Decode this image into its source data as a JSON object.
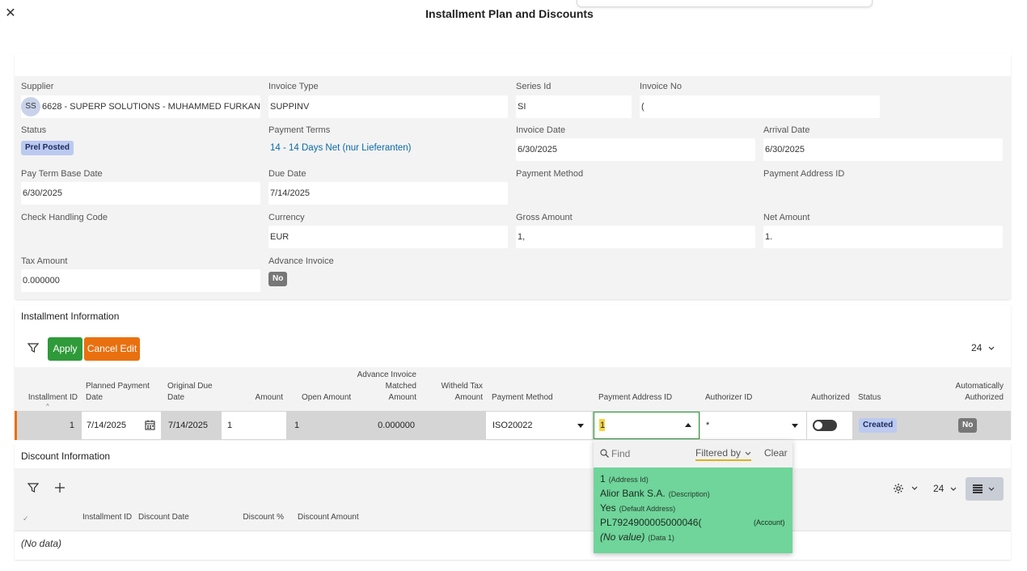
{
  "dialog": {
    "title": "Installment Plan and Discounts"
  },
  "header": {
    "supplier": {
      "label": "Supplier",
      "initials": "SS",
      "value": "6628 - SUPERP SOLUTIONS - MUHAMMED FURKAN ..."
    },
    "invoice_type": {
      "label": "Invoice Type",
      "value": "SUPPINV"
    },
    "series_id": {
      "label": "Series Id",
      "value": "SI"
    },
    "invoice_no": {
      "label": "Invoice No",
      "value": "("
    },
    "status": {
      "label": "Status",
      "value": "Prel Posted"
    },
    "payment_terms": {
      "label": "Payment Terms",
      "value": "14 - 14 Days Net (nur Lieferanten)"
    },
    "invoice_date": {
      "label": "Invoice Date",
      "value": "6/30/2025"
    },
    "arrival_date": {
      "label": "Arrival Date",
      "value": "6/30/2025"
    },
    "pay_term_base_date": {
      "label": "Pay Term Base Date",
      "value": "6/30/2025"
    },
    "due_date": {
      "label": "Due Date",
      "value": "7/14/2025"
    },
    "payment_method": {
      "label": "Payment Method",
      "value": ""
    },
    "payment_address_id": {
      "label": "Payment Address ID",
      "value": ""
    },
    "check_handling_code": {
      "label": "Check Handling Code",
      "value": ""
    },
    "currency": {
      "label": "Currency",
      "value": "EUR"
    },
    "gross_amount": {
      "label": "Gross Amount",
      "value": "1,"
    },
    "net_amount": {
      "label": "Net Amount",
      "value": "1."
    },
    "tax_amount": {
      "label": "Tax Amount",
      "value": "0.000000"
    },
    "advance_invoice": {
      "label": "Advance Invoice",
      "value": "No"
    }
  },
  "installment": {
    "title": "Installment Information",
    "apply_label": "Apply",
    "cancel_label": "Cancel Edit",
    "page_size": "24",
    "columns": {
      "installment_id": "Installment ID",
      "planned_payment_date_1": "Planned Payment",
      "planned_payment_date_2": "Date",
      "original_due_date_1": "Original Due",
      "original_due_date_2": "Date",
      "amount": "Amount",
      "open_amount": "Open Amount",
      "adv_1": "Advance Invoice",
      "adv_2": "Matched",
      "adv_3": "Amount",
      "witheld_1": "Witheld Tax",
      "witheld_2": "Amount",
      "payment_method": "Payment Method",
      "payment_address_id": "Payment Address ID",
      "authorizer_id": "Authorizer ID",
      "authorized": "Authorized",
      "status": "Status",
      "auto_1": "Automatically",
      "auto_2": "Authorized"
    },
    "row": {
      "installment_id": "1",
      "planned_payment_date": "7/14/2025",
      "original_due_date": "7/14/2025",
      "amount": "1",
      "open_amount": "1",
      "advance_matched": "0.000000",
      "payment_method": "ISO20022",
      "payment_address_id": "1",
      "authorizer_id": "*",
      "status": "Created",
      "auto_authorized": "No"
    }
  },
  "lov": {
    "find_placeholder": "Find",
    "filtered_by": "Filtered by",
    "clear": "Clear",
    "item": {
      "address_id": "1",
      "address_id_tag": "(Address Id)",
      "description": "Alior Bank S.A.",
      "description_tag": "(Description)",
      "default_address": "Yes",
      "default_address_tag": "(Default Address)",
      "account": "PL7924900005000046(",
      "account_tag": "(Account)",
      "data1": "(No value)",
      "data1_tag": "(Data 1)"
    }
  },
  "discount": {
    "title": "Discount Information",
    "page_size": "24",
    "columns": {
      "installment_id": "Installment ID",
      "discount_date": "Discount Date",
      "discount_pct": "Discount %",
      "discount_amount": "Discount Amount"
    },
    "empty": "(No data)"
  }
}
